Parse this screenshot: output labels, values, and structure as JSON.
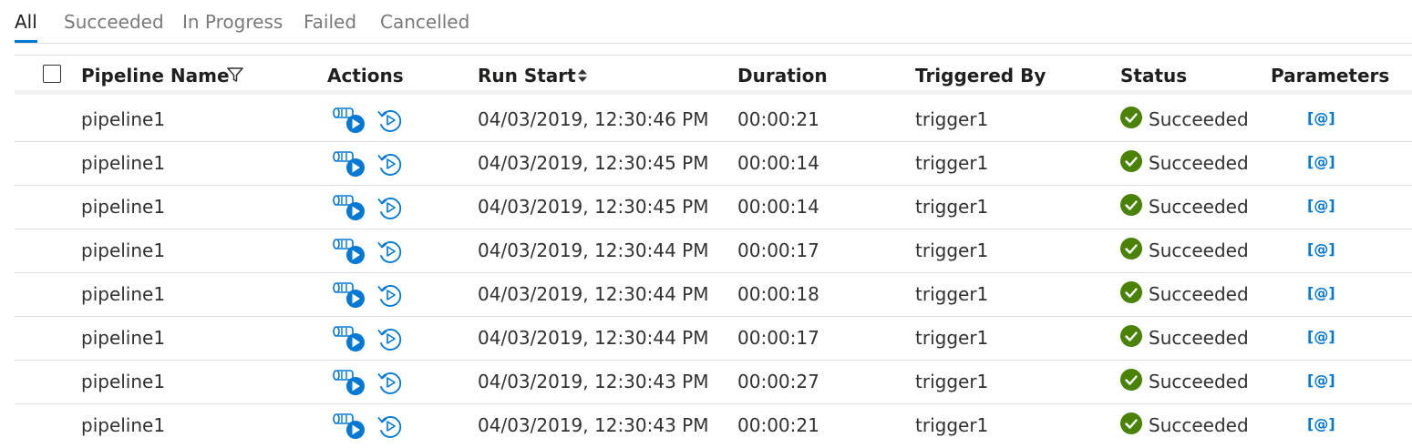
{
  "tabs": [
    {
      "label": "All",
      "active": true
    },
    {
      "label": "Succeeded",
      "active": false
    },
    {
      "label": "In Progress",
      "active": false
    },
    {
      "label": "Failed",
      "active": false
    },
    {
      "label": "Cancelled",
      "active": false
    }
  ],
  "columns": {
    "pipeline_name": "Pipeline Name",
    "actions": "Actions",
    "run_start": "Run Start",
    "duration": "Duration",
    "triggered_by": "Triggered By",
    "status": "Status",
    "parameters": "Parameters"
  },
  "colors": {
    "accent": "#0078d4",
    "success": "#498205"
  },
  "rows": [
    {
      "pipeline": "pipeline1",
      "run_start": "04/03/2019, 12:30:46 PM",
      "duration": "00:00:21",
      "triggered_by": "trigger1",
      "status": "Succeeded",
      "parameters": "[@]"
    },
    {
      "pipeline": "pipeline1",
      "run_start": "04/03/2019, 12:30:45 PM",
      "duration": "00:00:14",
      "triggered_by": "trigger1",
      "status": "Succeeded",
      "parameters": "[@]"
    },
    {
      "pipeline": "pipeline1",
      "run_start": "04/03/2019, 12:30:45 PM",
      "duration": "00:00:14",
      "triggered_by": "trigger1",
      "status": "Succeeded",
      "parameters": "[@]"
    },
    {
      "pipeline": "pipeline1",
      "run_start": "04/03/2019, 12:30:44 PM",
      "duration": "00:00:17",
      "triggered_by": "trigger1",
      "status": "Succeeded",
      "parameters": "[@]"
    },
    {
      "pipeline": "pipeline1",
      "run_start": "04/03/2019, 12:30:44 PM",
      "duration": "00:00:18",
      "triggered_by": "trigger1",
      "status": "Succeeded",
      "parameters": "[@]"
    },
    {
      "pipeline": "pipeline1",
      "run_start": "04/03/2019, 12:30:44 PM",
      "duration": "00:00:17",
      "triggered_by": "trigger1",
      "status": "Succeeded",
      "parameters": "[@]"
    },
    {
      "pipeline": "pipeline1",
      "run_start": "04/03/2019, 12:30:43 PM",
      "duration": "00:00:27",
      "triggered_by": "trigger1",
      "status": "Succeeded",
      "parameters": "[@]"
    },
    {
      "pipeline": "pipeline1",
      "run_start": "04/03/2019, 12:30:43 PM",
      "duration": "00:00:21",
      "triggered_by": "trigger1",
      "status": "Succeeded",
      "parameters": "[@]"
    }
  ]
}
